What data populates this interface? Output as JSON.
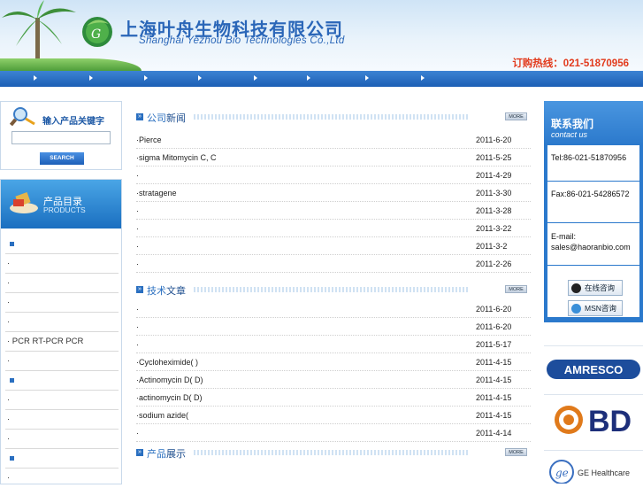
{
  "header": {
    "brand_cn": "上海叶舟生物科技有限公司",
    "brand_en": "Shanghai Yezhou Bio Technologies Co.,Ltd",
    "hotline": "订购热线：021-51870956"
  },
  "search": {
    "title": "输入产品关键字",
    "input_value": "",
    "button_label": "SEARCH"
  },
  "categories": {
    "title_cn": "产品目录",
    "title_en": "PRODUCTS",
    "items": [
      "",
      "·",
      "·",
      "·",
      "·",
      "· PCR RT-PCR  PCR",
      "·",
      "",
      "·",
      "·",
      "",
      "·"
    ]
  },
  "sections": {
    "news": {
      "title_prefix": "公司",
      "title_suffix": "新闻",
      "more": "MORE"
    },
    "articles": {
      "title_prefix": "技术",
      "title_suffix": "文章",
      "more": "MORE"
    },
    "products": {
      "title_prefix": "产品",
      "title_suffix": "展示",
      "more": "MORE"
    }
  },
  "news_rows": [
    {
      "title": "·Pierce",
      "date": "2011-6-20"
    },
    {
      "title": "·sigma  Mitomycin C,   C",
      "date": "2011-5-25"
    },
    {
      "title": "·",
      "date": "2011-4-29"
    },
    {
      "title": "·stratagene",
      "date": "2011-3-30"
    },
    {
      "title": "·",
      "date": "2011-3-28"
    },
    {
      "title": "·",
      "date": "2011-3-22"
    },
    {
      "title": "·",
      "date": "2011-3-2"
    },
    {
      "title": "·",
      "date": "2011-2-26"
    }
  ],
  "article_rows": [
    {
      "title": "·",
      "date": "2011-6-20"
    },
    {
      "title": "·",
      "date": "2011-6-20"
    },
    {
      "title": "·",
      "date": "2011-5-17"
    },
    {
      "title": "·Cycloheximide(    )",
      "date": "2011-4-15"
    },
    {
      "title": "·Actinomycin D(    D)",
      "date": "2011-4-15"
    },
    {
      "title": "·actinomycin D(    D)",
      "date": "2011-4-15"
    },
    {
      "title": "·sodium azide(",
      "date": "2011-4-15"
    },
    {
      "title": "·",
      "date": "2011-4-14"
    }
  ],
  "contact": {
    "title_cn": "联系我们",
    "title_en": "contact us",
    "tel": "Tel:86-021-51870956",
    "fax": "Fax:86-021-54286572",
    "email": "E-mail: sales@haoranbio.com",
    "online_label": "在线咨询",
    "msn_label": "MSN咨询"
  },
  "partners": [
    "AMRESCO",
    "BD",
    "GE Healthcare"
  ],
  "colors": {
    "nav_blue": "#1c5fb5",
    "hotline_red": "#e23a1c",
    "brand_blue": "#2a66b8"
  }
}
